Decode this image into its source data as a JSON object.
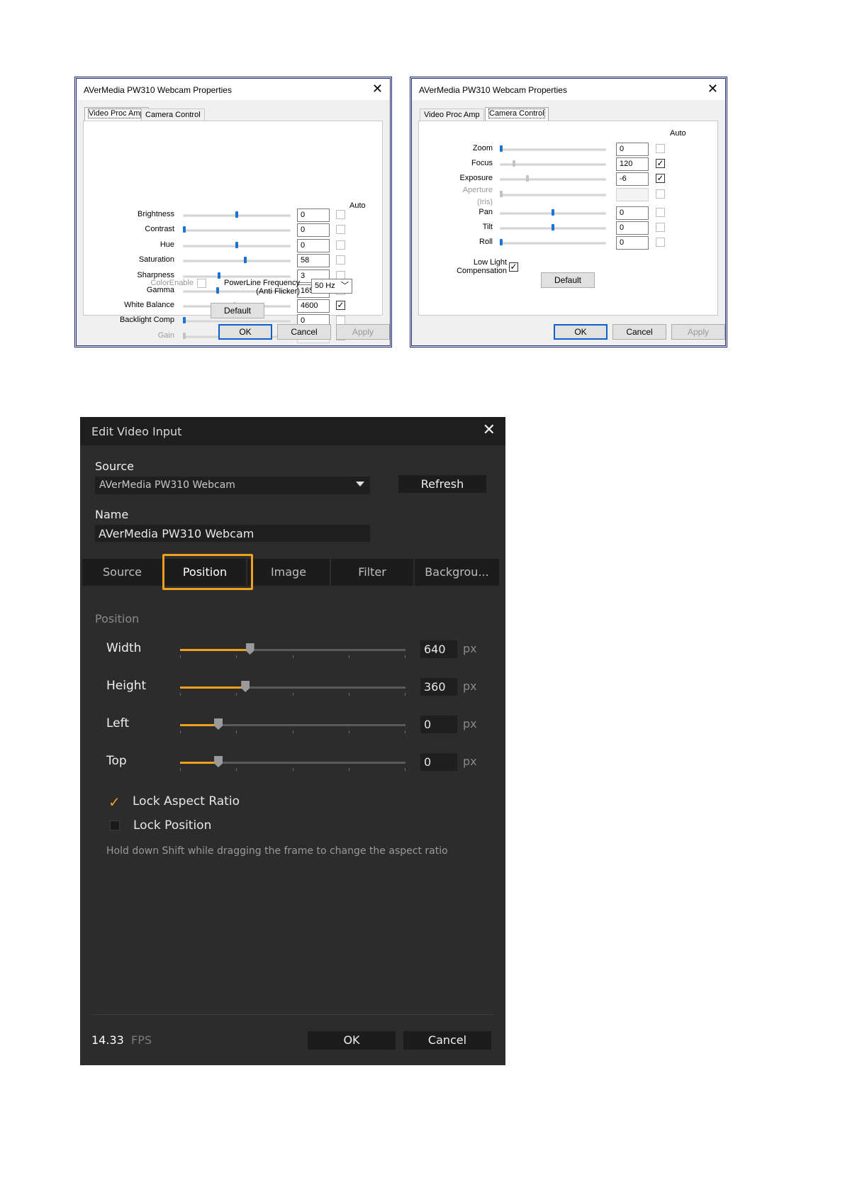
{
  "dialog1": {
    "title": "AVerMedia PW310 Webcam Properties",
    "tabs": [
      "Video Proc Amp",
      "Camera Control"
    ],
    "auto_label": "Auto",
    "rows": [
      {
        "label": "Brightness",
        "value": "0",
        "auto": false
      },
      {
        "label": "Contrast",
        "value": "0",
        "auto": false
      },
      {
        "label": "Hue",
        "value": "0",
        "auto": false
      },
      {
        "label": "Saturation",
        "value": "58",
        "auto": false
      },
      {
        "label": "Sharpness",
        "value": "3",
        "auto": false
      },
      {
        "label": "Gamma",
        "value": "165",
        "auto": false
      },
      {
        "label": "White Balance",
        "value": "4600",
        "auto": true
      },
      {
        "label": "Backlight Comp",
        "value": "0",
        "auto": false
      },
      {
        "label": "Gain",
        "value": "",
        "auto": false
      }
    ],
    "color_enable": "ColorEnable",
    "powerline_label": "PowerLine Frequency",
    "powerline_sub": "(Anti Flicker)",
    "powerline_value": "50 Hz",
    "default_button": "Default",
    "ok": "OK",
    "cancel": "Cancel",
    "apply": "Apply"
  },
  "dialog2": {
    "title": "AVerMedia PW310 Webcam Properties",
    "tabs": [
      "Video Proc Amp",
      "Camera Control"
    ],
    "auto_label": "Auto",
    "rows": [
      {
        "label": "Zoom",
        "value": "0",
        "auto": false
      },
      {
        "label": "Focus",
        "value": "120",
        "auto": true
      },
      {
        "label": "Exposure",
        "value": "-6",
        "auto": true
      },
      {
        "label": "Aperture",
        "sub": "(Iris)",
        "value": "",
        "auto": false
      },
      {
        "label": "Pan",
        "value": "0",
        "auto": false
      },
      {
        "label": "Tilt",
        "value": "0",
        "auto": false
      },
      {
        "label": "Roll",
        "value": "0",
        "auto": false
      }
    ],
    "low_light": "Low Light",
    "low_light_sub": "Compensation",
    "default_button": "Default",
    "ok": "OK",
    "cancel": "Cancel",
    "apply": "Apply"
  },
  "editor": {
    "title": "Edit Video Input",
    "close_icon": "close-icon",
    "source_label": "Source",
    "source_value": "AVerMedia PW310 Webcam",
    "refresh": "Refresh",
    "name_label": "Name",
    "name_value": "AVerMedia PW310 Webcam",
    "tabs": [
      "Source",
      "Position",
      "Image",
      "Filter",
      "Backgrou..."
    ],
    "active_tab": "Position",
    "section": "Position",
    "sliders": [
      {
        "label": "Width",
        "value": "640",
        "unit": "px",
        "level": 0.31
      },
      {
        "label": "Height",
        "value": "360",
        "unit": "px",
        "level": 0.29
      },
      {
        "label": "Left",
        "value": "0",
        "unit": "px",
        "level": 0.17
      },
      {
        "label": "Top",
        "value": "0",
        "unit": "px",
        "level": 0.17
      }
    ],
    "lock_aspect": "Lock Aspect Ratio",
    "lock_aspect_checked": true,
    "lock_position": "Lock Position",
    "lock_position_checked": false,
    "hint": "Hold down Shift while dragging the frame to change the aspect ratio",
    "fps_value": "14.33",
    "fps_unit": "FPS",
    "ok": "OK",
    "cancel": "Cancel",
    "accent": "#f0a020"
  }
}
